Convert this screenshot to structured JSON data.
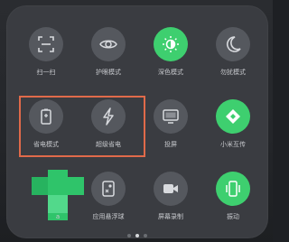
{
  "panel": {
    "tiles": [
      {
        "label": "扫一扫",
        "icon": "scan-icon",
        "active": false
      },
      {
        "label": "护眼模式",
        "icon": "eye-icon",
        "active": false
      },
      {
        "label": "深色模式",
        "icon": "dark-mode-icon",
        "active": true
      },
      {
        "label": "勿扰模式",
        "icon": "moon-icon",
        "active": false
      },
      {
        "label": "省电模式",
        "icon": "battery-icon",
        "active": false
      },
      {
        "label": "超级省电",
        "icon": "lightning-icon",
        "active": false
      },
      {
        "label": "投屏",
        "icon": "cast-screen-icon",
        "active": false
      },
      {
        "label": "小米互传",
        "icon": "mi-share-icon",
        "active": true
      },
      {
        "label": "应用悬浮球",
        "icon": "floating-ball-icon",
        "active": false
      },
      {
        "label": "屏幕录制",
        "icon": "video-record-icon",
        "active": false
      },
      {
        "label": "振动",
        "icon": "vibrate-icon",
        "active": true
      }
    ],
    "partial_label": "a"
  },
  "colors": {
    "active": "#3ecf6f",
    "inactive": "#55585e",
    "highlight": "#e06a4a",
    "panel": "#3a3c41"
  },
  "pager": {
    "pages": 3,
    "current": 1
  }
}
